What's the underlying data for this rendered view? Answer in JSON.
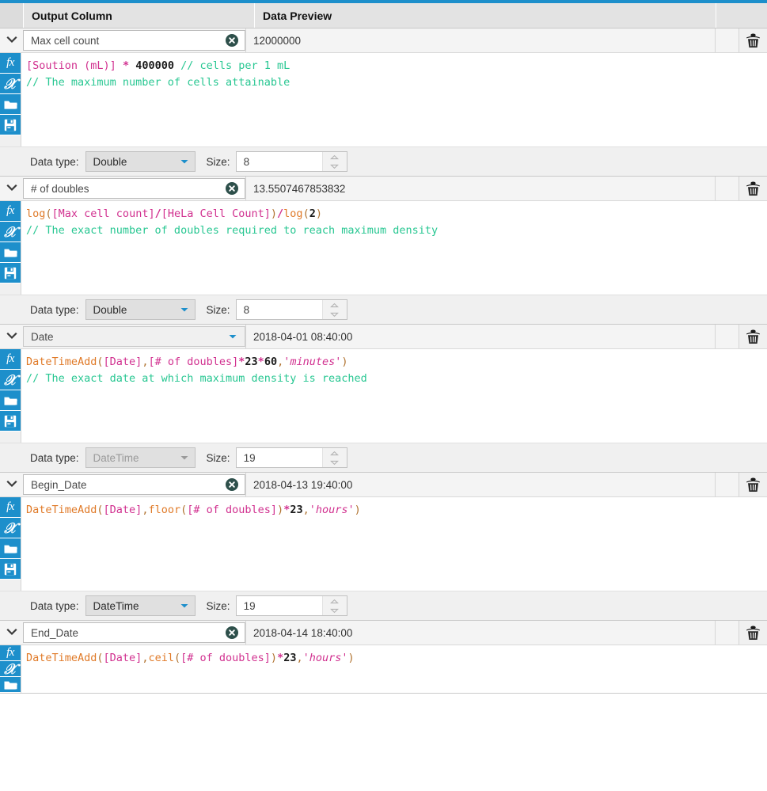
{
  "theme": {
    "accent": "#1d8fcb",
    "header_bg": "#e3e3e3",
    "clear_btn_bg": "#2e504b",
    "comment_color": "#28c792",
    "function_color": "#e07a28",
    "reference_color": "#d1308f"
  },
  "header": {
    "output_column": "Output Column",
    "data_preview": "Data Preview"
  },
  "labels": {
    "data_type": "Data type:",
    "size": "Size:"
  },
  "icons": {
    "function": "fx",
    "variable": "X",
    "open": "open-folder-icon",
    "save": "save-icon",
    "delete": "trash-icon",
    "clear": "clear-icon",
    "expand": "chevron-down-icon"
  },
  "columns": [
    {
      "name": "Max cell count",
      "preview": "12000000",
      "has_clear": true,
      "has_dropdown": false,
      "data_type": "Double",
      "type_disabled": false,
      "size": "8",
      "formula_lines": [
        [
          {
            "t": "[Soution (mL)]",
            "c": "tk-ref"
          },
          {
            "t": " ",
            "c": "tk-plain"
          },
          {
            "t": "*",
            "c": "tk-op"
          },
          {
            "t": " ",
            "c": "tk-plain"
          },
          {
            "t": "400000",
            "c": "tk-num"
          },
          {
            "t": " ",
            "c": "tk-plain"
          },
          {
            "t": "// cells per 1 mL",
            "c": "tk-cmt"
          }
        ],
        [
          {
            "t": "// The maximum number of cells attainable",
            "c": "tk-cmt"
          }
        ]
      ]
    },
    {
      "name": "# of doubles",
      "preview": "13.5507467853832",
      "has_clear": true,
      "has_dropdown": false,
      "data_type": "Double",
      "type_disabled": false,
      "size": "8",
      "formula_lines": [
        [
          {
            "t": "log",
            "c": "tk-fn"
          },
          {
            "t": "(",
            "c": "tk-punc"
          },
          {
            "t": "[Max cell count]",
            "c": "tk-ref"
          },
          {
            "t": "/",
            "c": "tk-op"
          },
          {
            "t": "[HeLa Cell Count]",
            "c": "tk-ref"
          },
          {
            "t": ")",
            "c": "tk-punc"
          },
          {
            "t": "/",
            "c": "tk-op"
          },
          {
            "t": "log",
            "c": "tk-fn"
          },
          {
            "t": "(",
            "c": "tk-punc"
          },
          {
            "t": "2",
            "c": "tk-num"
          },
          {
            "t": ")",
            "c": "tk-punc"
          }
        ],
        [
          {
            "t": "// The exact number of doubles required to reach maximum density",
            "c": "tk-cmt"
          }
        ]
      ]
    },
    {
      "name": "Date",
      "preview": "2018-04-01 08:40:00",
      "has_clear": false,
      "has_dropdown": true,
      "data_type": "DateTime",
      "type_disabled": true,
      "size": "19",
      "formula_lines": [
        [
          {
            "t": "DateTimeAdd",
            "c": "tk-fn"
          },
          {
            "t": "(",
            "c": "tk-punc"
          },
          {
            "t": "[Date]",
            "c": "tk-ref"
          },
          {
            "t": ",",
            "c": "tk-punc"
          },
          {
            "t": "[# of doubles]",
            "c": "tk-ref"
          },
          {
            "t": "*",
            "c": "tk-op"
          },
          {
            "t": "23",
            "c": "tk-num"
          },
          {
            "t": "*",
            "c": "tk-op"
          },
          {
            "t": "60",
            "c": "tk-num"
          },
          {
            "t": ",",
            "c": "tk-punc"
          },
          {
            "t": "'minutes'",
            "c": "tk-str"
          },
          {
            "t": ")",
            "c": "tk-punc"
          }
        ],
        [
          {
            "t": "// The exact date at which maximum density is reached",
            "c": "tk-cmt"
          }
        ]
      ]
    },
    {
      "name": "Begin_Date",
      "preview": "2018-04-13 19:40:00",
      "has_clear": true,
      "has_dropdown": false,
      "data_type": "DateTime",
      "type_disabled": false,
      "size": "19",
      "formula_lines": [
        [
          {
            "t": "DateTimeAdd",
            "c": "tk-fn"
          },
          {
            "t": "(",
            "c": "tk-punc"
          },
          {
            "t": "[Date]",
            "c": "tk-ref"
          },
          {
            "t": ",",
            "c": "tk-punc"
          },
          {
            "t": "floor",
            "c": "tk-fn"
          },
          {
            "t": "(",
            "c": "tk-punc"
          },
          {
            "t": "[# of doubles]",
            "c": "tk-ref"
          },
          {
            "t": ")",
            "c": "tk-punc"
          },
          {
            "t": "*",
            "c": "tk-op"
          },
          {
            "t": "23",
            "c": "tk-num"
          },
          {
            "t": ",",
            "c": "tk-punc"
          },
          {
            "t": "'hours'",
            "c": "tk-str"
          },
          {
            "t": ")",
            "c": "tk-punc"
          }
        ],
        []
      ]
    },
    {
      "name": "End_Date",
      "preview": "2018-04-14 18:40:00",
      "has_clear": true,
      "has_dropdown": false,
      "data_type": "",
      "type_disabled": false,
      "size": "",
      "truncated": true,
      "formula_lines": [
        [
          {
            "t": "DateTimeAdd",
            "c": "tk-fn"
          },
          {
            "t": "(",
            "c": "tk-punc"
          },
          {
            "t": "[Date]",
            "c": "tk-ref"
          },
          {
            "t": ",",
            "c": "tk-punc"
          },
          {
            "t": "ceil",
            "c": "tk-fn"
          },
          {
            "t": "(",
            "c": "tk-punc"
          },
          {
            "t": "[# of doubles]",
            "c": "tk-ref"
          },
          {
            "t": ")",
            "c": "tk-punc"
          },
          {
            "t": "*",
            "c": "tk-op"
          },
          {
            "t": "23",
            "c": "tk-num"
          },
          {
            "t": ",",
            "c": "tk-punc"
          },
          {
            "t": "'hours'",
            "c": "tk-str"
          },
          {
            "t": ")",
            "c": "tk-punc"
          }
        ],
        []
      ]
    }
  ]
}
